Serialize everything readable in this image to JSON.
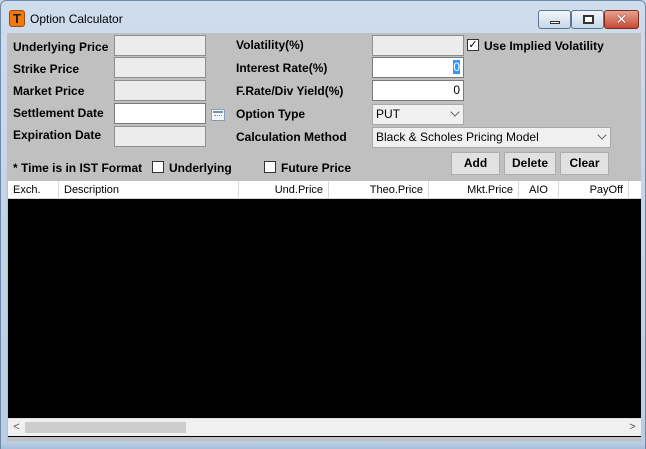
{
  "window": {
    "app_icon_letter": "T",
    "title": "Option Calculator"
  },
  "form": {
    "underlying_price_label": "Underlying Price",
    "underlying_price_value": "",
    "strike_price_label": "Strike Price",
    "strike_price_value": "",
    "market_price_label": "Market Price",
    "market_price_value": "",
    "settlement_date_label": "Settlement Date",
    "settlement_date_value": "",
    "expiration_date_label": "Expiration Date",
    "expiration_date_value": "",
    "volatility_label": "Volatility(%)",
    "volatility_value": "",
    "use_implied_label": "Use Implied Volatility",
    "use_implied_checked": true,
    "interest_rate_label": "Interest Rate(%)",
    "interest_rate_value": "0",
    "frate_label": "F.Rate/Div Yield(%)",
    "frate_value": "0",
    "option_type_label": "Option Type",
    "option_type_value": "PUT",
    "calc_method_label": "Calculation Method",
    "calc_method_value": "Black & Scholes Pricing Model",
    "time_note": "* Time is in IST Format",
    "underlying_chk_label": "Underlying",
    "underlying_chk_checked": false,
    "future_price_label": "Future Price",
    "future_price_checked": false
  },
  "buttons": {
    "add": "Add",
    "delete": "Delete",
    "clear": "Clear"
  },
  "grid": {
    "columns": [
      "Exch.",
      "Description",
      "Und.Price",
      "Theo.Price",
      "Mkt.Price",
      "AIO",
      "PayOff"
    ],
    "rows": []
  },
  "colors": {
    "client_bg": "#c0c0c0",
    "grid_bg": "#000000",
    "title_bg": "#cfdcec",
    "close_btn": "#c74a35",
    "selection": "#3399ff"
  },
  "icons": {
    "app": "app-t-icon",
    "minimize": "minimize-icon",
    "maximize": "maximize-icon",
    "close": "close-icon",
    "calendar": "calendar-icon",
    "scroll_left": "scroll-left-icon",
    "scroll_right": "scroll-right-icon",
    "dropdown": "chevron-down-icon"
  }
}
